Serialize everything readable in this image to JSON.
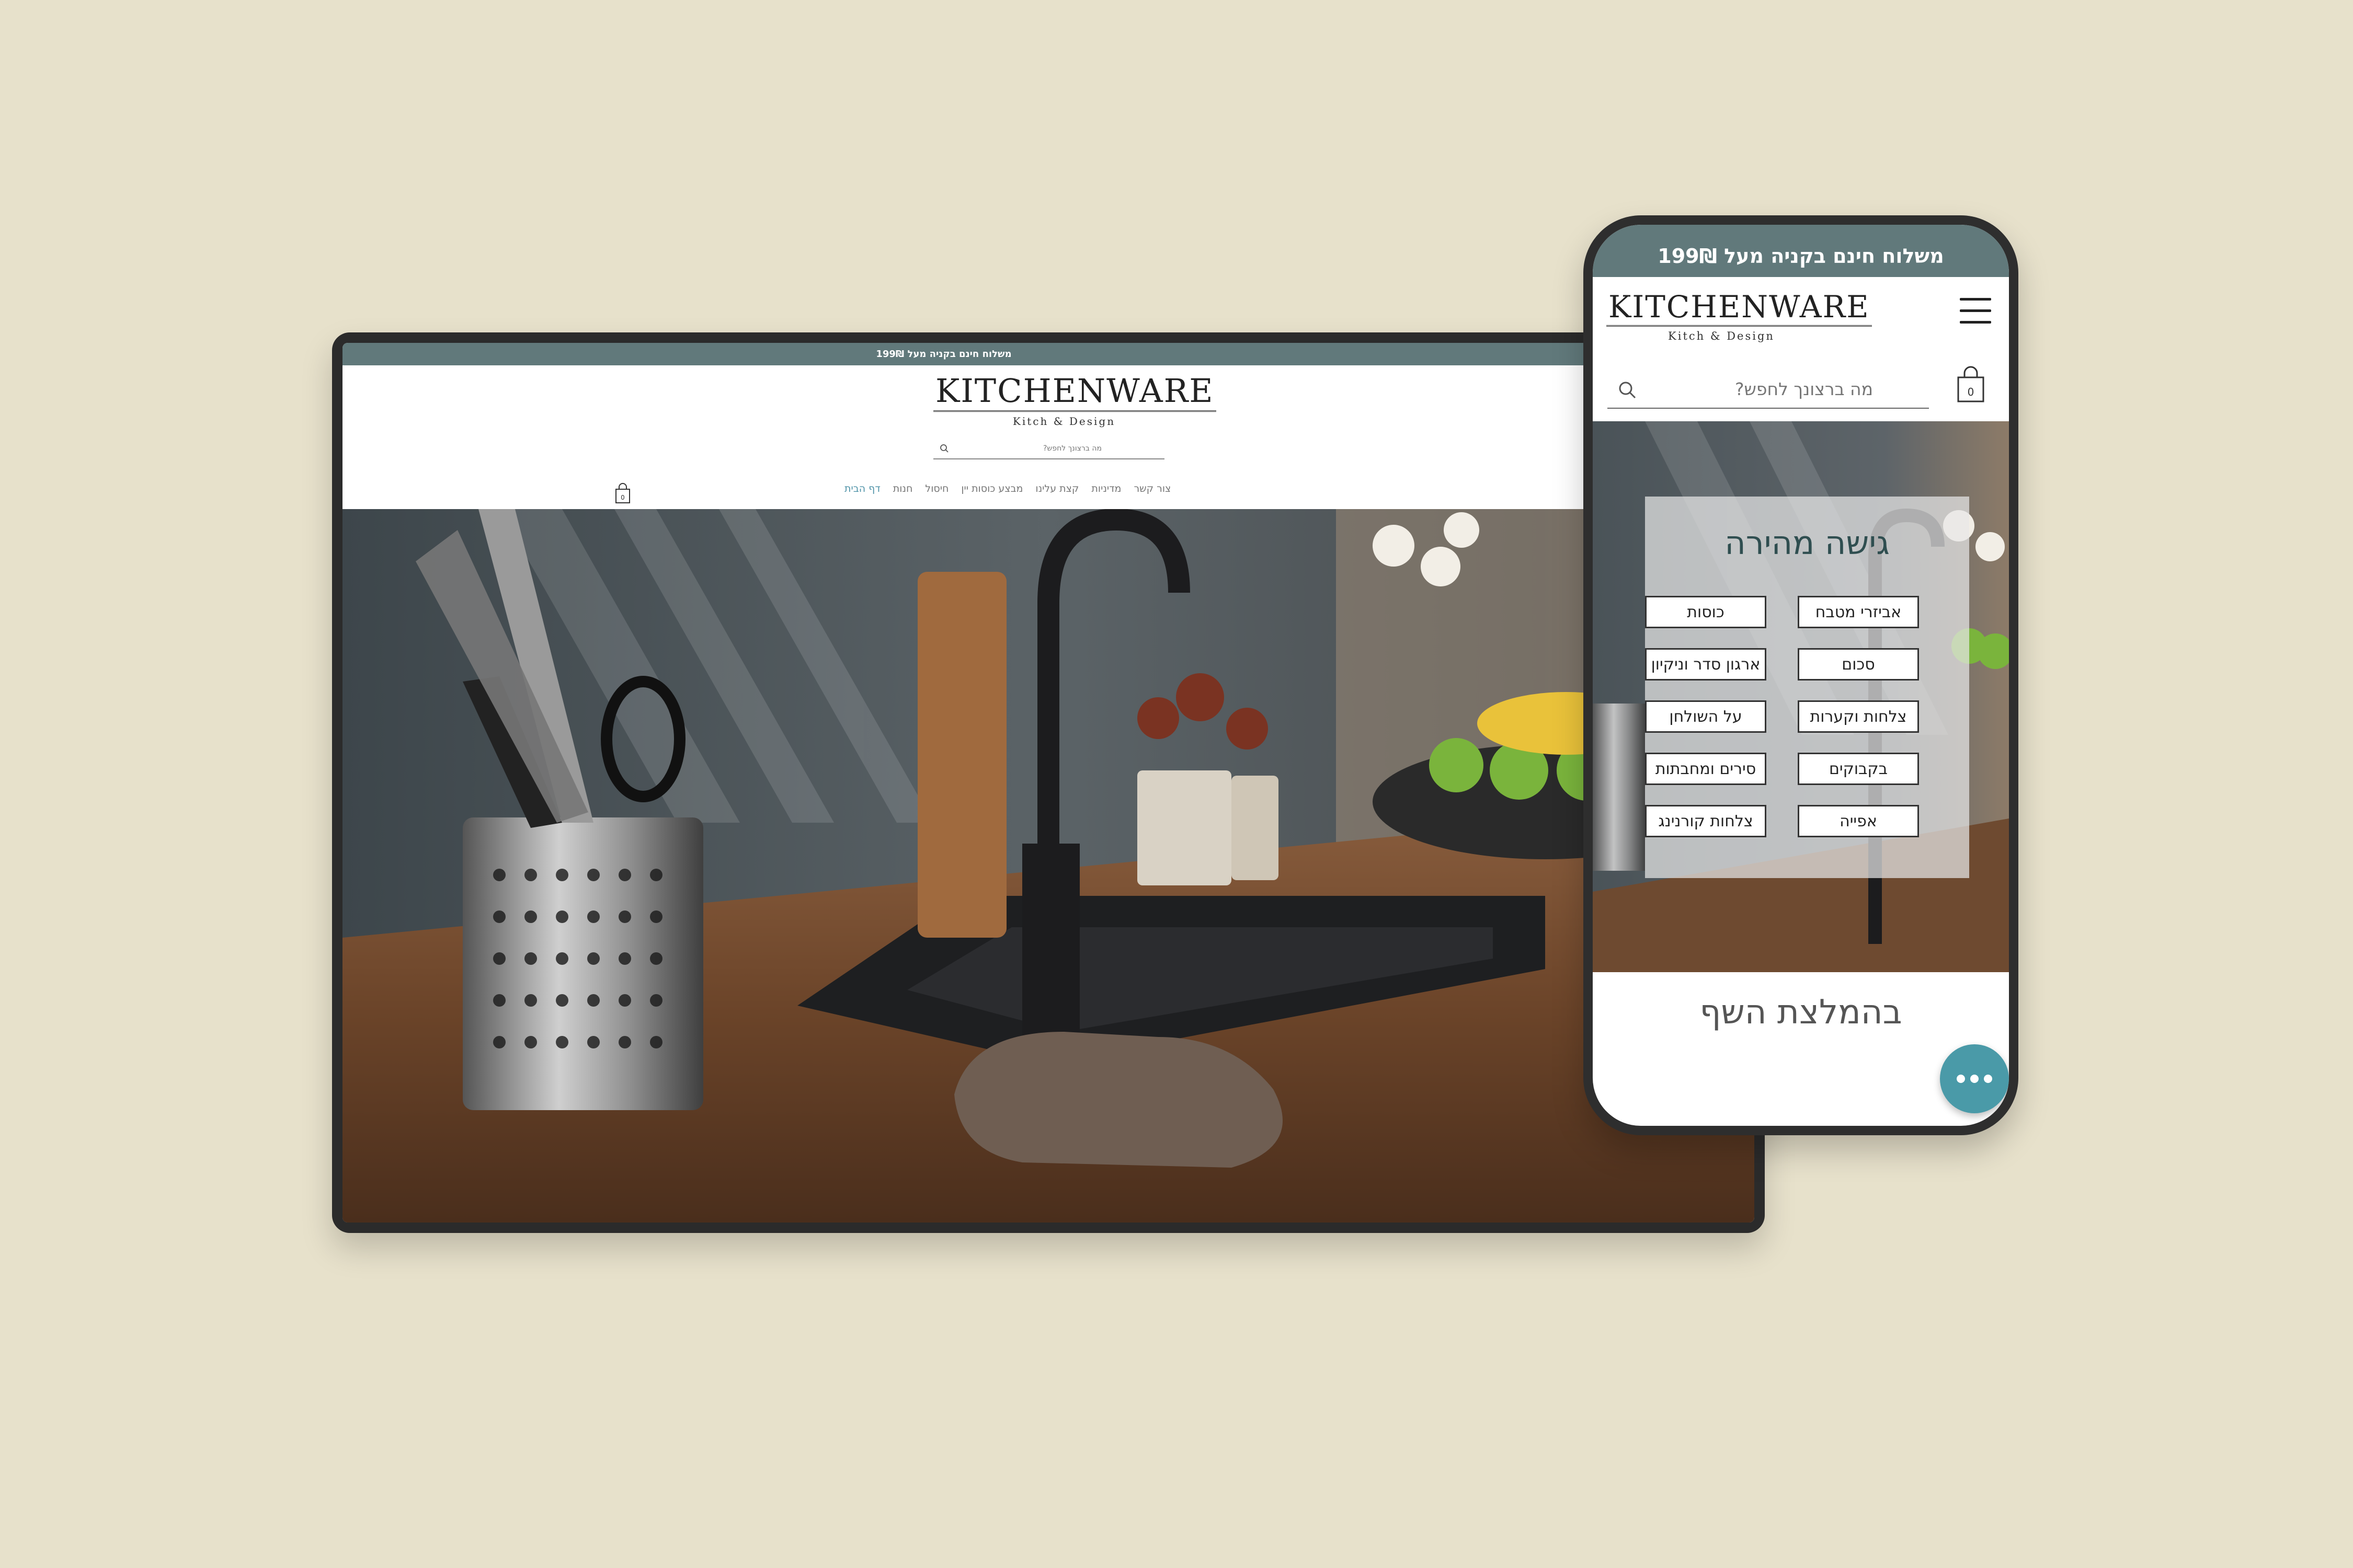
{
  "desktop": {
    "banner": "משלוח חינם בקניה מעל 199₪",
    "logo": {
      "title": "KITCHENWARE",
      "subtitle": "Kitch & Design"
    },
    "search": {
      "placeholder": "מה ברצונך לחפש?"
    },
    "nav": [
      "דף הבית",
      "חנות",
      "חיסול",
      "מבצע כוסות יין",
      "קצת עלינו",
      "מדיניות",
      "צור קשר"
    ],
    "cart_count": "0"
  },
  "phone": {
    "banner": "משלוח חינם בקניה מעל 199₪",
    "logo": {
      "title": "KITCHENWARE",
      "subtitle": "Kitch & Design"
    },
    "search": {
      "placeholder": "מה ברצונך לחפש?"
    },
    "cart_count": "0",
    "quick_access": {
      "title": "גישה מהירה",
      "buttons": [
        "אביזרי מטבח",
        "כוסות",
        "סכום",
        "ארגון סדר וניקיון",
        "צלחות וקערות",
        "על השולחן",
        "בקבוקים",
        "סירים ומחבתות",
        "אפייה",
        "צלחות קורנינג"
      ]
    },
    "chef_heading": "בהמלצת השף"
  },
  "colors": {
    "banner": "#61797b",
    "accent": "#4f93a8",
    "background": "#e7e1cb",
    "chat_button": "#4a9aa8"
  },
  "icons": [
    "search-icon",
    "cart-icon",
    "menu-icon",
    "chat-icon"
  ]
}
